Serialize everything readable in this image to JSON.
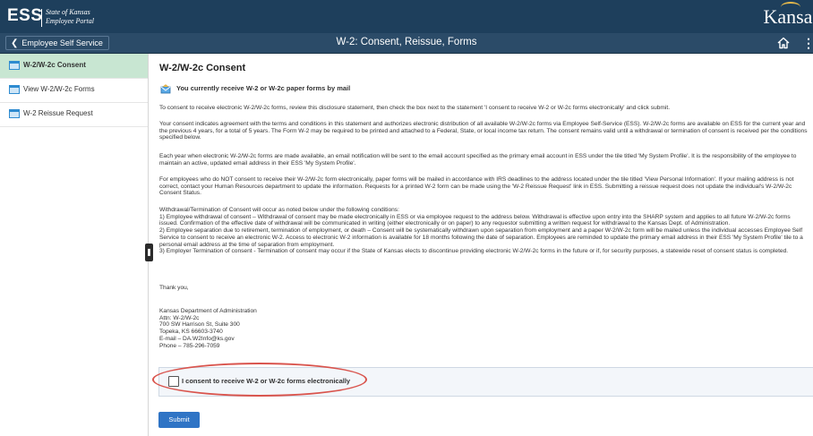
{
  "header": {
    "logo": "ESS",
    "tagline_line1": "State of Kansas",
    "tagline_line2": "Employee Portal",
    "state_logo": "Kansas"
  },
  "nav": {
    "back_label": "Employee Self Service",
    "title": "W-2: Consent, Reissue, Forms",
    "home_icon": "home-icon",
    "menu_icon": "kebab-menu-icon"
  },
  "sidebar": {
    "items": [
      {
        "label": "W-2/W-2c Consent",
        "active": true
      },
      {
        "label": "View W-2/W-2c Forms",
        "active": false
      },
      {
        "label": "W-2 Reissue Request",
        "active": false
      }
    ]
  },
  "main": {
    "heading": "W-2/W-2c Consent",
    "notice": "You currently receive W-2 or W-2c paper forms by mail",
    "paragraphs": [
      "To consent to receive electronic W-2/W-2c forms, review this disclosure statement, then check the box next to the statement 'I consent to receive W-2 or W-2c forms electronically' and click submit.",
      "Your consent indicates agreement with the terms and conditions in this statement and authorizes electronic distribution of all available W-2/W-2c forms via Employee Self-Service (ESS). W-2/W-2c forms are available on ESS for the current year and the previous 4 years, for a total of 5 years. The Form W-2 may be required to be printed and attached to a Federal, State, or local income tax return.  The consent remains valid until a withdrawal or termination of consent is received per the conditions specified below.",
      "Each year when electronic W-2/W-2c forms are made available, an email notification will be sent to the email account specified as the primary email account in ESS under the tile titled 'My System Profile'.  It is the responsibility of the employee to maintain an active, updated email address in their ESS 'My System Profile'.",
      "For employees who do NOT consent to receive their W-2/W-2c form electronically, paper forms will be mailed in accordance with IRS deadlines to the address located under the tile titled 'View Personal Information'.  If your mailing address is not correct, contact your Human Resources department to update the information.  Requests for a printed W-2 form can be made using the 'W-2 Reissue Request' link in ESS.  Submitting a reissue request does not update the individual's W-2/W-2c Consent Status.",
      "Withdrawal/Termination of Consent will occur as noted below under the following conditions:\n1) Employee withdrawal of consent – Withdrawal of consent may be made electronically in ESS or via employee request to the address below.  Withdrawal is effective upon entry into the SHARP system and applies to all future W-2/W-2c forms issued.  Confirmation of the effective date of withdrawal will be communicated in writing (either electronically or on paper) to any requestor submitting a written request for withdrawal to the Kansas Dept. of Administration.\n2) Employee separation due to retirement, termination of employment, or death – Consent will be systematically withdrawn upon separation from employment and a paper W-2/W-2c form will be mailed unless the individual accesses Employee Self Service to consent to receive an electronic W-2.  Access to electronic W-2 information is available for 18 months following the date of separation.  Employees are reminded to update the primary email address in their ESS 'My System Profile' tile to a personal email address at the time of separation from employment.\n3) Employer Termination of consent - Termination of consent may occur if the State of Kansas elects to discontinue providing electronic W-2/W-2c forms in the future or if, for security purposes, a statewide reset of consent status is completed.",
      "Thank you,",
      "Kansas Department of Administration\nAttn: W-2/W-2c\n700 SW Harrison St, Suite 300\nTopeka, KS  66603-3740\nE-mail – DA.W2Info@ks.gov\nPhone – 785-296-7059"
    ],
    "consent_label": "I consent to receive W-2 or W-2c forms electronically",
    "consent_checked": false,
    "submit_label": "Submit"
  },
  "colors": {
    "topbar": "#1e3f5c",
    "navbar": "#2b4b68",
    "sidebar_active": "#c8e6d2",
    "button": "#2f74c5",
    "highlight_oval": "#d9544d"
  }
}
